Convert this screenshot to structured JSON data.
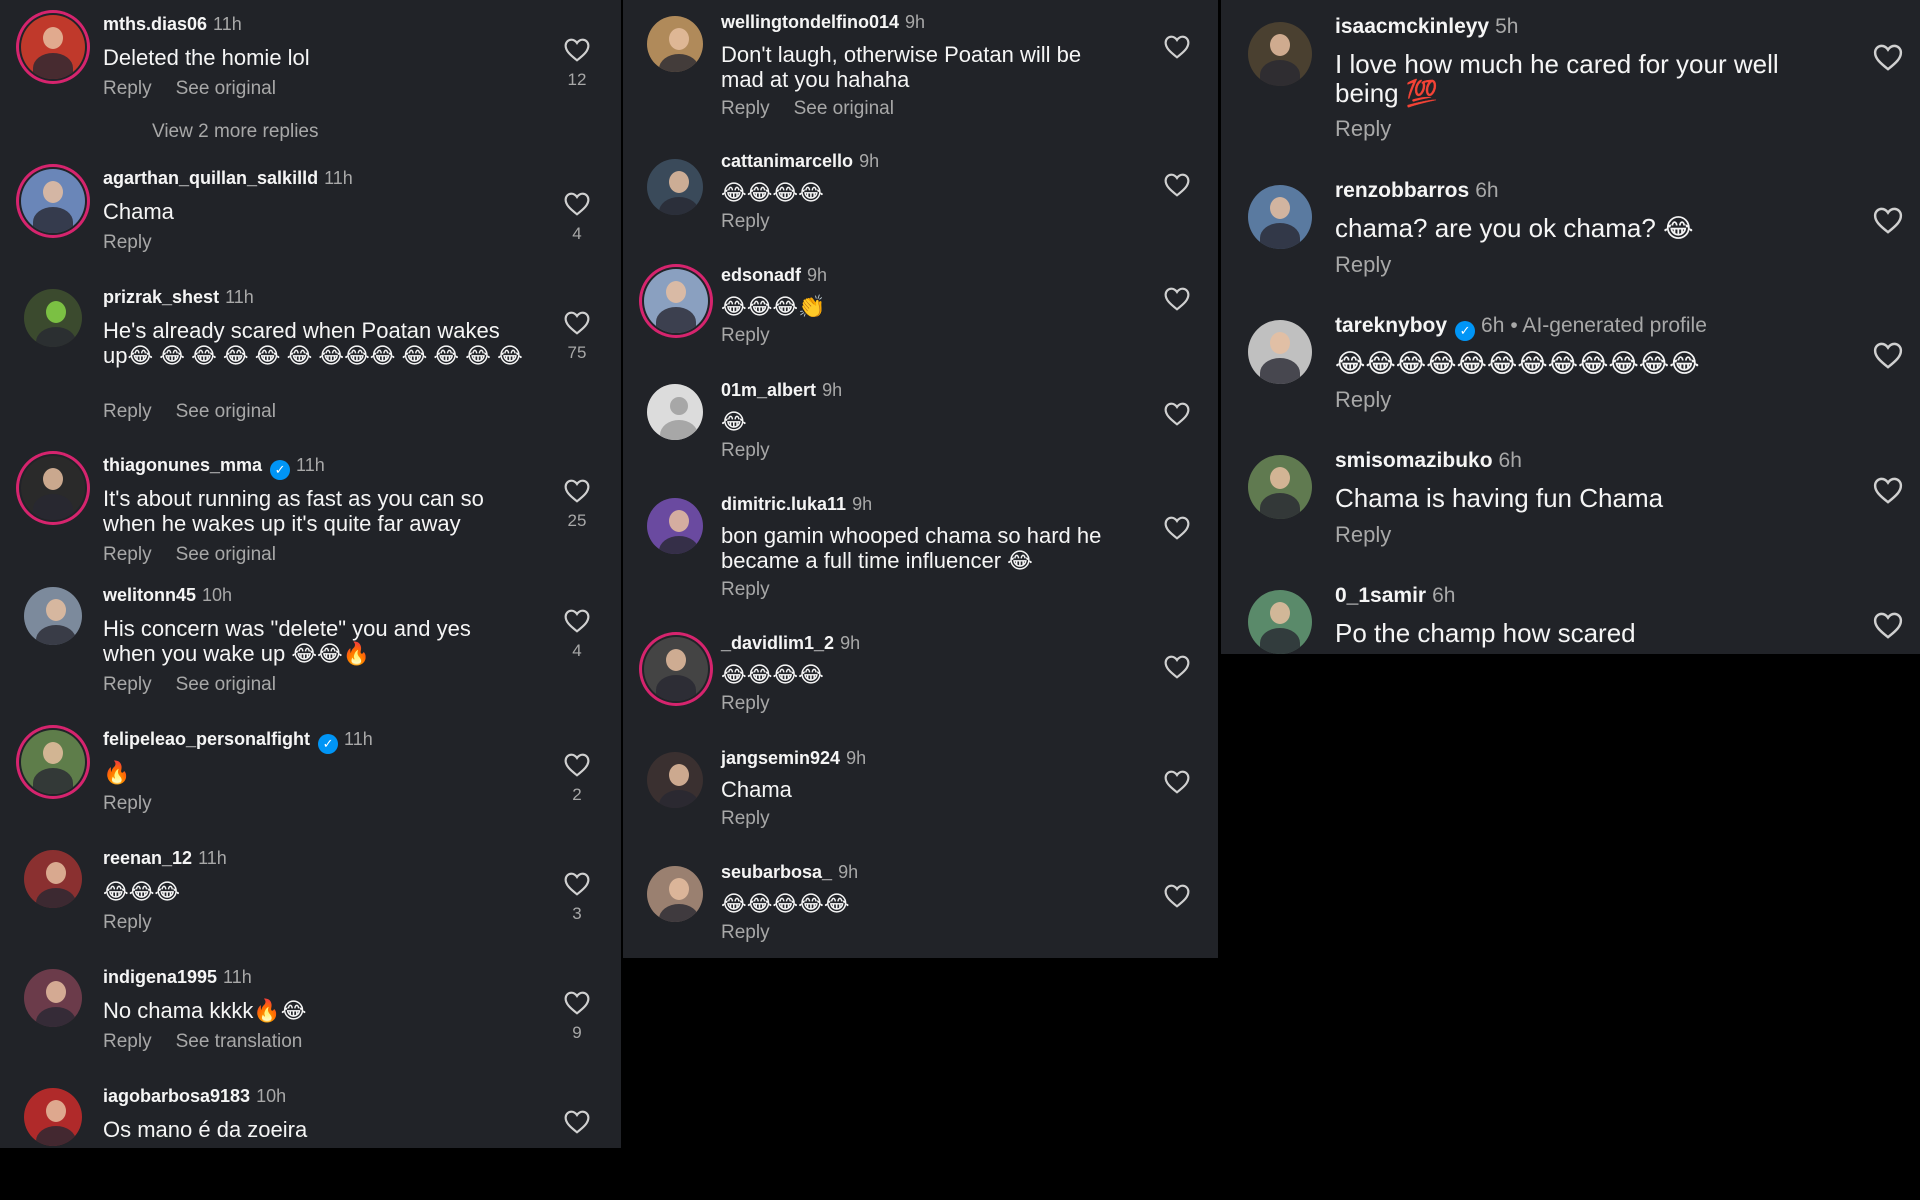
{
  "panel1": {
    "view_more_replies": "View 2 more replies",
    "comments": [
      {
        "username": "mths.dias06",
        "time": "11h",
        "text": "Deleted the homie lol",
        "reply": "Reply",
        "secondary": "See original",
        "likes": "12",
        "avatar_color": "#c0392b"
      },
      {
        "username": "agarthan_quillan_salkilld",
        "time": "11h",
        "text": "Chama",
        "reply": "Reply",
        "secondary": "",
        "likes": "4",
        "avatar_color": "#6a86b8"
      },
      {
        "username": "prizrak_shest",
        "time": "11h",
        "text": "He's already scared when Poatan wakes up😂 😂 😂 😂 😂 😂 😂😂😂 😂 😂 😂 😂",
        "reply": "Reply",
        "secondary": "See original",
        "likes": "75",
        "avatar_color": "#3b4a2e"
      },
      {
        "username": "thiagonunes_mma",
        "time": "11h",
        "verified": true,
        "text": "It's about running as fast as you can so when he wakes up it's quite far away",
        "reply": "Reply",
        "secondary": "See original",
        "likes": "25",
        "avatar_color": "#2a2a2a"
      },
      {
        "username": "welitonn45",
        "time": "10h",
        "text": "His concern was \"delete\" you and yes when you wake up 😂😂🔥",
        "reply": "Reply",
        "secondary": "See original",
        "likes": "4",
        "avatar_color": "#7c8a9c"
      },
      {
        "username": "felipeleao_personalfight",
        "time": "11h",
        "verified": true,
        "text": "🔥",
        "reply": "Reply",
        "secondary": "",
        "likes": "2",
        "avatar_color": "#5e7d4a"
      },
      {
        "username": "reenan_12",
        "time": "11h",
        "text": "😂😂😂",
        "reply": "Reply",
        "secondary": "",
        "likes": "3",
        "avatar_color": "#8a3030"
      },
      {
        "username": "indigena1995",
        "time": "11h",
        "text": "No chama kkkk🔥😂",
        "reply": "Reply",
        "secondary": "See translation",
        "likes": "9",
        "avatar_color": "#6b3b4a"
      },
      {
        "username": "iagobarbosa9183",
        "time": "10h",
        "text": "Os mano é da zoeira",
        "reply": "",
        "secondary": "",
        "likes": "",
        "avatar_color": "#b02a2a"
      }
    ]
  },
  "panel2": {
    "comments": [
      {
        "username": "wellingtondelfino014",
        "time": "9h",
        "text": "Don't laugh, otherwise Poatan will be mad at you hahaha",
        "reply": "Reply",
        "secondary": "See original",
        "avatar_color": "#b08a5a"
      },
      {
        "username": "cattanimarcello",
        "time": "9h",
        "text": "😂😂😂😂",
        "reply": "Reply",
        "secondary": "",
        "avatar_color": "#3a4a5a"
      },
      {
        "username": "edsonadf",
        "time": "9h",
        "text": "😂😂😂👏",
        "reply": "Reply",
        "secondary": "",
        "avatar_color": "#8aa0c0"
      },
      {
        "username": "01m_albert",
        "time": "9h",
        "text": "😂",
        "reply": "Reply",
        "secondary": "",
        "avatar_color": "#dcdcdc",
        "placeholder": true
      },
      {
        "username": "dimitric.luka11",
        "time": "9h",
        "text": "bon gamin whooped chama so hard he became a full time influencer 😂",
        "reply": "Reply",
        "secondary": "",
        "avatar_color": "#6a4aa0"
      },
      {
        "username": "_davidlim1_2",
        "time": "9h",
        "text": "😂😂😂😂",
        "reply": "Reply",
        "secondary": "",
        "avatar_color": "#444444"
      },
      {
        "username": "jangsemin924",
        "time": "9h",
        "text": "Chama",
        "reply": "Reply",
        "secondary": "",
        "avatar_color": "#3a3030"
      },
      {
        "username": "seubarbosa_",
        "time": "9h",
        "text": "😂😂😂😂😂",
        "reply": "Reply",
        "secondary": "",
        "avatar_color": "#9a8070"
      }
    ]
  },
  "panel3": {
    "comments": [
      {
        "username": "isaacmckinleyy",
        "time": "5h",
        "text": "I love how much he cared for your well being 💯",
        "reply": "Reply",
        "avatar_color": "#4a4030"
      },
      {
        "username": "renzobbarros",
        "time": "6h",
        "text": "chama? are you ok chama? 😂",
        "reply": "Reply",
        "avatar_color": "#5a7aa0"
      },
      {
        "username": "tareknyboy",
        "time": "6h",
        "verified": true,
        "ai_label": "• AI-generated profile",
        "text": "😂😂😂😂😂😂😂😂😂😂😂😂",
        "reply": "Reply",
        "avatar_color": "#c0c0c0"
      },
      {
        "username": "smisomazibuko",
        "time": "6h",
        "text": "Chama is having fun Chama",
        "reply": "Reply",
        "avatar_color": "#607a50"
      },
      {
        "username": "0_1samir",
        "time": "6h",
        "text": "Po the champ how scared",
        "reply": "",
        "avatar_color": "#5a8a6a"
      }
    ]
  }
}
